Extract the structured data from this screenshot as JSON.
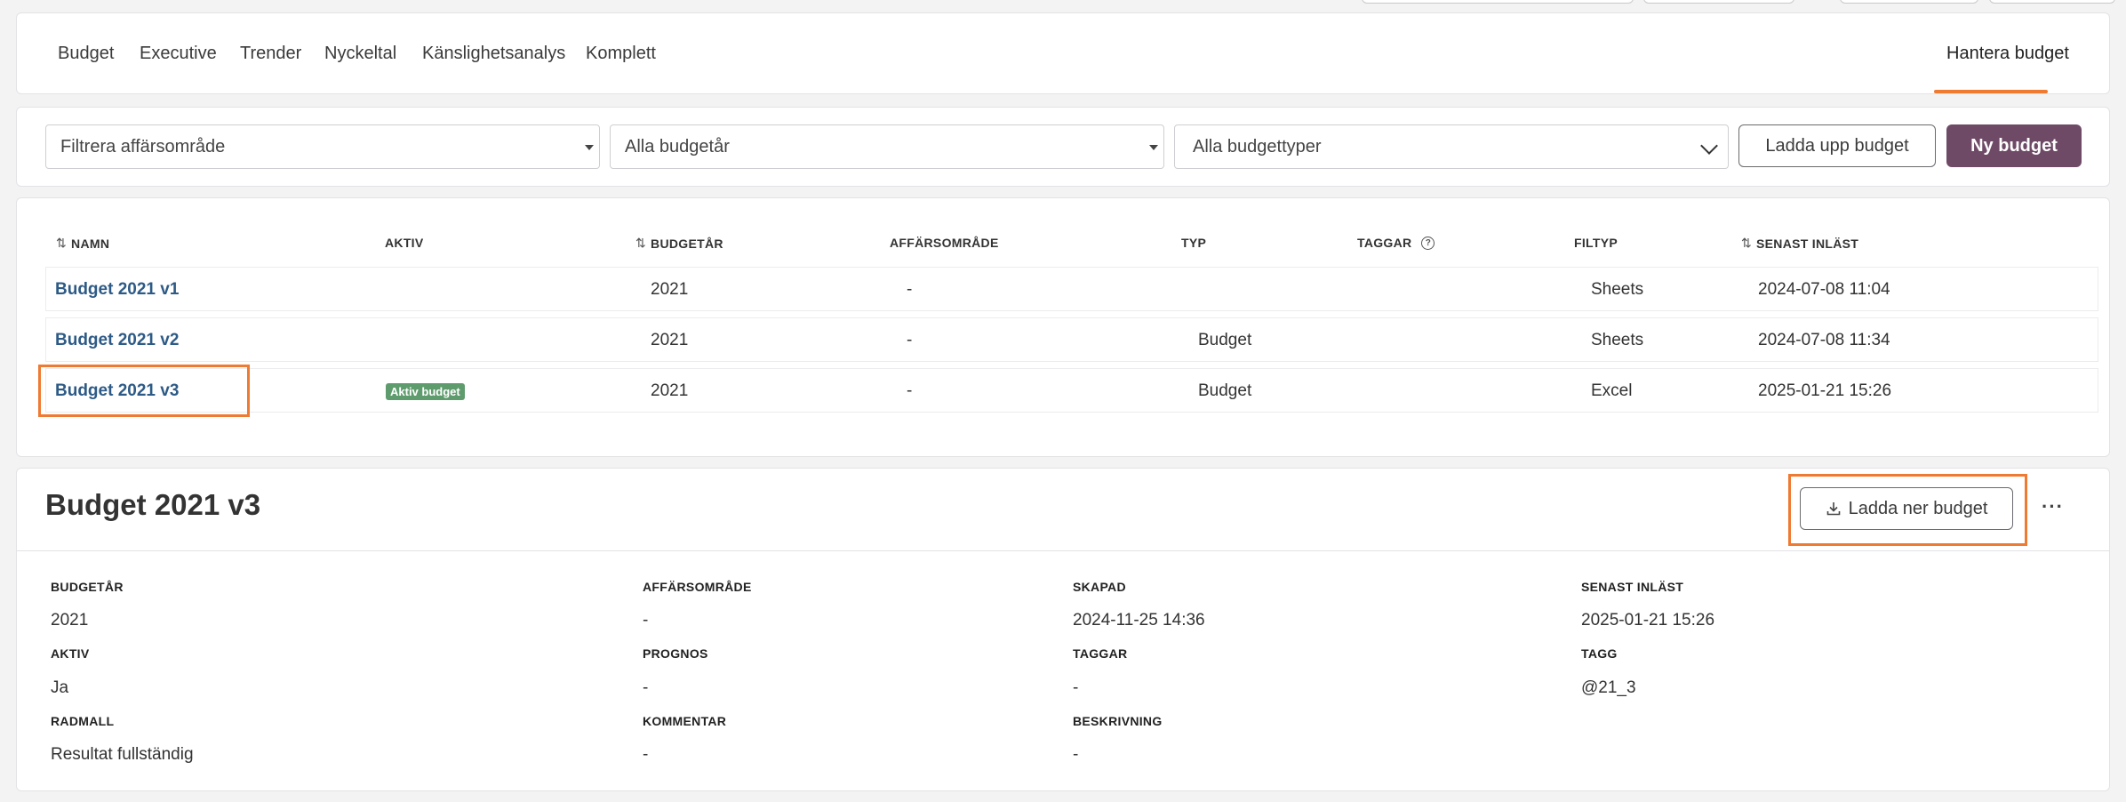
{
  "nav": {
    "tabs": [
      "Budget",
      "Executive",
      "Trender",
      "Nyckeltal",
      "Känslighetsanalys",
      "Komplett"
    ],
    "right_tab": "Hantera budget"
  },
  "filters": {
    "business_area": "Filtrera affärsområde",
    "budget_year": "Alla budgetår",
    "budget_type": "Alla budgettyper",
    "upload_label": "Ladda upp budget",
    "new_label": "Ny budget"
  },
  "table": {
    "headers": {
      "name": "NAMN",
      "active": "AKTIV",
      "year": "BUDGETÅR",
      "area": "AFFÄRSOMRÅDE",
      "type": "TYP",
      "tags": "TAGGAR",
      "filetype": "FILTYP",
      "loaded": "SENAST INLÄST"
    },
    "rows": [
      {
        "name": "Budget 2021 v1",
        "active": "",
        "year": "2021",
        "area": "-",
        "type": "",
        "filetype": "Sheets",
        "loaded": "2024-07-08 11:04"
      },
      {
        "name": "Budget 2021 v2",
        "active": "",
        "year": "2021",
        "area": "-",
        "type": "Budget",
        "filetype": "Sheets",
        "loaded": "2024-07-08 11:34"
      },
      {
        "name": "Budget 2021 v3",
        "active": "Aktiv budget",
        "year": "2021",
        "area": "-",
        "type": "Budget",
        "filetype": "Excel",
        "loaded": "2025-01-21 15:26"
      }
    ]
  },
  "detail": {
    "title": "Budget 2021 v3",
    "download_label": "Ladda ner budget",
    "more": "···",
    "fields": {
      "budgetar_label": "BUDGETÅR",
      "budgetar": "2021",
      "affarsomrade_label": "AFFÄRSOMRÅDE",
      "affarsomrade": "-",
      "skapad_label": "SKAPAD",
      "skapad": "2024-11-25 14:36",
      "senast_label": "SENAST INLÄST",
      "senast": "2025-01-21 15:26",
      "aktiv_label": "AKTIV",
      "aktiv": "Ja",
      "prognos_label": "PROGNOS",
      "prognos": "-",
      "taggar_label": "TAGGAR",
      "taggar": "-",
      "tagg_label": "TAGG",
      "tagg": "@21_3",
      "radmall_label": "RADMALL",
      "radmall": "Resultat fullständig",
      "kommentar_label": "KOMMENTAR",
      "kommentar": "-",
      "beskrivning_label": "BESKRIVNING",
      "beskrivning": "-"
    }
  },
  "colors": {
    "accent": "#ef7a32",
    "primary": "#6e4a67",
    "link": "#2d5a86",
    "badge": "#5f9c6d"
  }
}
